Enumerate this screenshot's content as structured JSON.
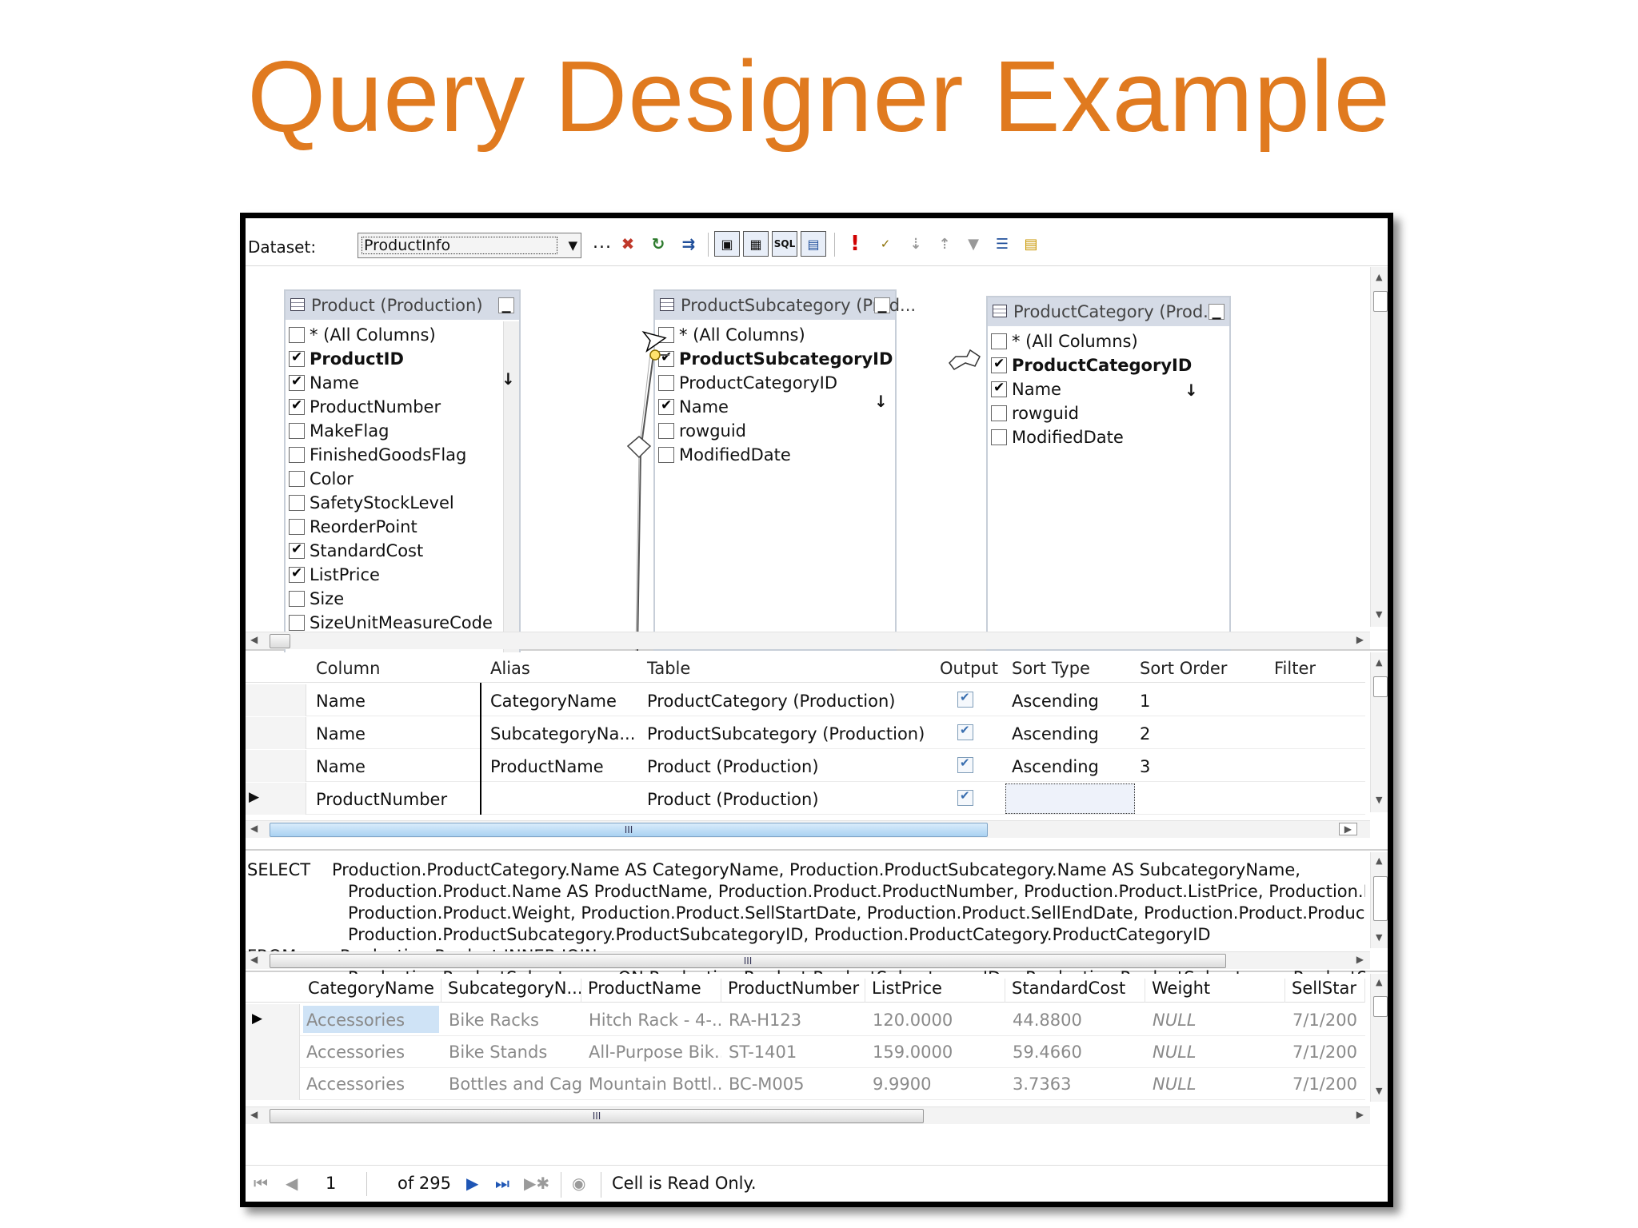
{
  "slide": {
    "title": "Query Designer Example"
  },
  "toolbar": {
    "dataset_label": "Dataset:",
    "dataset_value": "ProductInfo",
    "dataset_more": "...",
    "icons": [
      "delete-table-icon",
      "refresh-icon",
      "import-icon",
      "diagram-pane-icon",
      "grid-pane-icon",
      "sql-pane-icon",
      "result-pane-icon",
      "run-icon",
      "verify-sql-icon",
      "sort-ascending-icon",
      "sort-descending-icon",
      "remove-filter-icon",
      "group-by-icon",
      "add-table-icon"
    ],
    "sql_label": "SQL",
    "run_label": "!"
  },
  "diagram": {
    "tables": [
      {
        "title": "Product (Production)",
        "columns": [
          {
            "name": "* (All Columns)",
            "checked": false,
            "bold": false
          },
          {
            "name": "ProductID",
            "checked": true,
            "bold": true
          },
          {
            "name": "Name",
            "checked": true,
            "bold": false
          },
          {
            "name": "ProductNumber",
            "checked": true,
            "bold": false
          },
          {
            "name": "MakeFlag",
            "checked": false,
            "bold": false
          },
          {
            "name": "FinishedGoodsFlag",
            "checked": false,
            "bold": false
          },
          {
            "name": "Color",
            "checked": false,
            "bold": false
          },
          {
            "name": "SafetyStockLevel",
            "checked": false,
            "bold": false
          },
          {
            "name": "ReorderPoint",
            "checked": false,
            "bold": false
          },
          {
            "name": "StandardCost",
            "checked": true,
            "bold": false
          },
          {
            "name": "ListPrice",
            "checked": true,
            "bold": false
          },
          {
            "name": "Size",
            "checked": false,
            "bold": false
          },
          {
            "name": "SizeUnitMeasureCode",
            "checked": false,
            "bold": false
          }
        ]
      },
      {
        "title": "ProductSubcategory (Prod...",
        "columns": [
          {
            "name": "* (All Columns)",
            "checked": false,
            "bold": false
          },
          {
            "name": "ProductSubcategoryID",
            "checked": true,
            "bold": true
          },
          {
            "name": "ProductCategoryID",
            "checked": false,
            "bold": false
          },
          {
            "name": "Name",
            "checked": true,
            "bold": false
          },
          {
            "name": "rowguid",
            "checked": false,
            "bold": false
          },
          {
            "name": "ModifiedDate",
            "checked": false,
            "bold": false
          }
        ]
      },
      {
        "title": "ProductCategory (Prod...",
        "columns": [
          {
            "name": "* (All Columns)",
            "checked": false,
            "bold": false
          },
          {
            "name": "ProductCategoryID",
            "checked": true,
            "bold": true
          },
          {
            "name": "Name",
            "checked": true,
            "bold": false
          },
          {
            "name": "rowguid",
            "checked": false,
            "bold": false
          },
          {
            "name": "ModifiedDate",
            "checked": false,
            "bold": false
          }
        ]
      }
    ]
  },
  "criteria": {
    "headers": [
      "Column",
      "Alias",
      "Table",
      "Output",
      "Sort Type",
      "Sort Order",
      "Filter"
    ],
    "rows": [
      {
        "column": "Name",
        "alias": "CategoryName",
        "table": "ProductCategory (Production)",
        "sort_type": "Ascending",
        "sort_order": "1"
      },
      {
        "column": "Name",
        "alias": "SubcategoryNa...",
        "table": "ProductSubcategory (Production)",
        "sort_type": "Ascending",
        "sort_order": "2"
      },
      {
        "column": "Name",
        "alias": "ProductName",
        "table": "Product (Production)",
        "sort_type": "Ascending",
        "sort_order": "3"
      },
      {
        "column": "ProductNumber",
        "alias": "",
        "table": "Product (Production)",
        "sort_type": "",
        "sort_order": ""
      }
    ],
    "scroll_grip": "III"
  },
  "sql": {
    "lines": [
      {
        "kw": "SELECT",
        "text": "Production.ProductCategory.Name AS CategoryName, Production.ProductSubcategory.Name AS SubcategoryName,"
      },
      {
        "kw": "",
        "text": "Production.Product.Name AS ProductName, Production.Product.ProductNumber, Production.Product.ListPrice, Production.Product.S"
      },
      {
        "kw": "",
        "text": "Production.Product.Weight, Production.Product.SellStartDate, Production.Product.SellEndDate, Production.Product.ProductID,"
      },
      {
        "kw": "",
        "text": "Production.ProductSubcategory.ProductSubcategoryID, Production.ProductCategory.ProductCategoryID"
      },
      {
        "kw": "FROM",
        "text": "Production.Product INNER JOIN"
      },
      {
        "kw": "",
        "text": "Production.ProductSubcategory ON Production.Product.ProductSubcategoryID = Production.ProductSubcategory.ProductSubcategoi"
      }
    ],
    "scroll_grip": "III"
  },
  "results": {
    "headers": [
      "CategoryName",
      "SubcategoryN...",
      "ProductName",
      "ProductNumber",
      "ListPrice",
      "StandardCost",
      "Weight",
      "SellStar"
    ],
    "rows": [
      [
        "Accessories",
        "Bike Racks",
        "Hitch Rack - 4-...",
        "RA-H123",
        "120.0000",
        "44.8800",
        "NULL",
        "7/1/200"
      ],
      [
        "Accessories",
        "Bike Stands",
        "All-Purpose Bik...",
        "ST-1401",
        "159.0000",
        "59.4660",
        "NULL",
        "7/1/200"
      ],
      [
        "Accessories",
        "Bottles and Cag...",
        "Mountain Bottl...",
        "BC-M005",
        "9.9900",
        "3.7363",
        "NULL",
        "7/1/200"
      ]
    ],
    "scroll_grip": "III"
  },
  "navbar": {
    "position": "1",
    "of_text": "of 295",
    "status": "Cell is Read Only."
  }
}
